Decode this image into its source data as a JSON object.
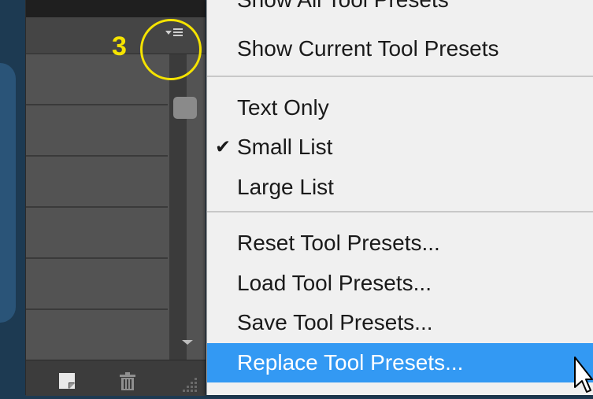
{
  "annotation": {
    "step_number": "3",
    "highlight_color": "#f5e300"
  },
  "panel": {
    "flyout_icon": "panel-menu-icon",
    "rows": [
      "",
      "",
      "",
      "",
      "",
      ""
    ],
    "footer_icons": [
      "new-preset-icon",
      "trash-icon"
    ]
  },
  "menu": {
    "cut_off_item": "Show All Tool Presets",
    "items": [
      {
        "label": "Show Current Tool Presets",
        "checked": false,
        "highlighted": false
      },
      {
        "label": "Text Only",
        "checked": false,
        "highlighted": false
      },
      {
        "label": "Small List",
        "checked": true,
        "highlighted": false
      },
      {
        "label": "Large List",
        "checked": false,
        "highlighted": false
      },
      {
        "label": "Reset Tool Presets...",
        "checked": false,
        "highlighted": false
      },
      {
        "label": "Load Tool Presets...",
        "checked": false,
        "highlighted": false
      },
      {
        "label": "Save Tool Presets...",
        "checked": false,
        "highlighted": false
      },
      {
        "label": "Replace Tool Presets...",
        "checked": false,
        "highlighted": true
      }
    ],
    "check_glyph": "✔",
    "highlight_color": "#3399f3"
  }
}
